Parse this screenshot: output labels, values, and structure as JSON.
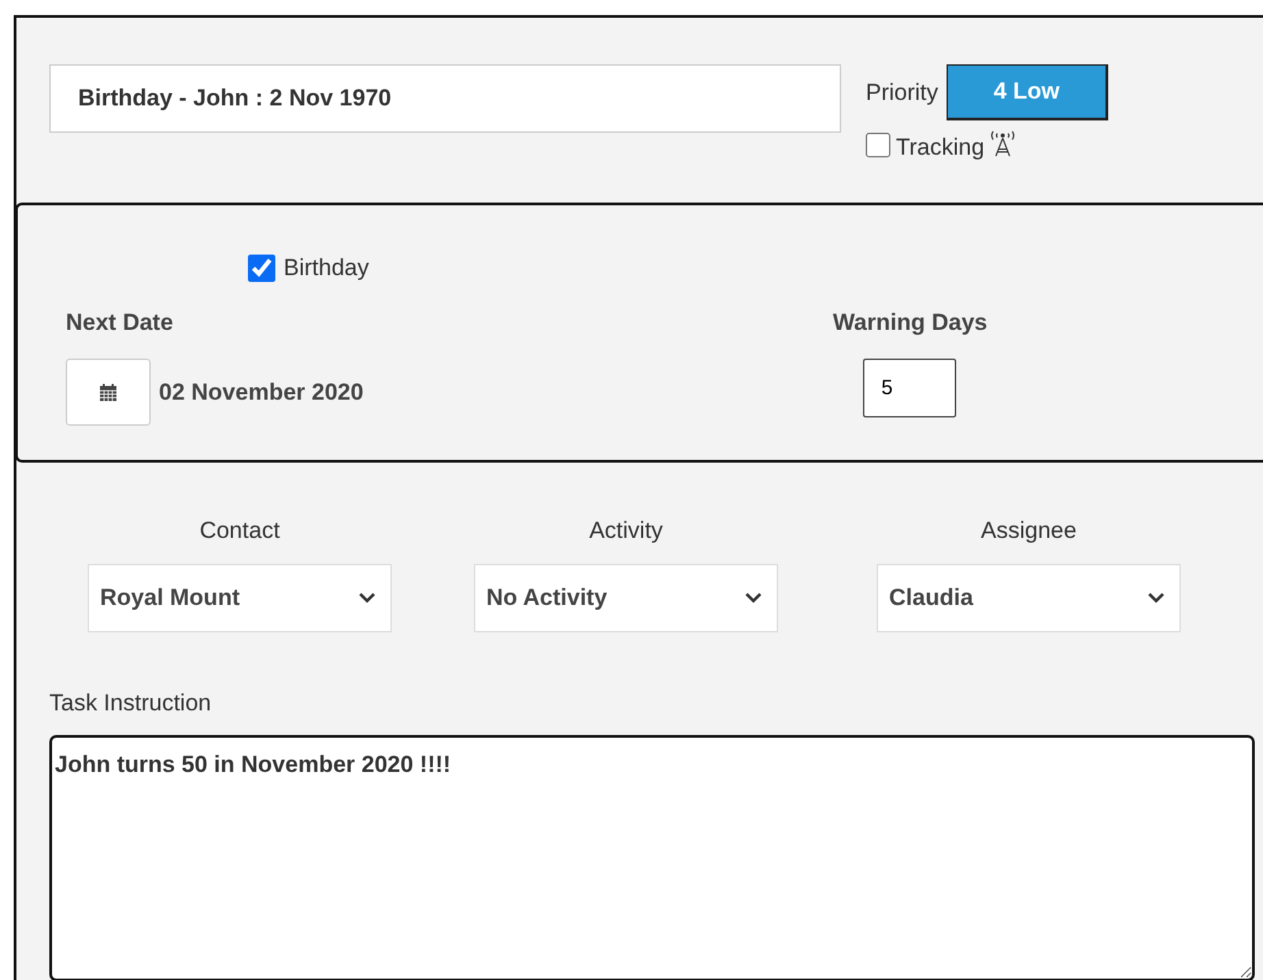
{
  "title_field": {
    "value": "Birthday - John : 2 Nov 1970"
  },
  "priority": {
    "label": "Priority",
    "value": "4 Low"
  },
  "tracking": {
    "label": "Tracking",
    "checked": false
  },
  "schedule": {
    "birthday": {
      "label": "Birthday",
      "checked": true
    },
    "next_date": {
      "label": "Next Date",
      "value": "02 November 2020"
    },
    "warning_days": {
      "label": "Warning Days",
      "value": "5"
    }
  },
  "selects": [
    {
      "label": "Contact",
      "value": "Royal Mount"
    },
    {
      "label": "Activity",
      "value": "No Activity"
    },
    {
      "label": "Assignee",
      "value": "Claudia"
    }
  ],
  "task_instruction": {
    "label": "Task Instruction",
    "value": "John turns 50 in November 2020 !!!!"
  }
}
